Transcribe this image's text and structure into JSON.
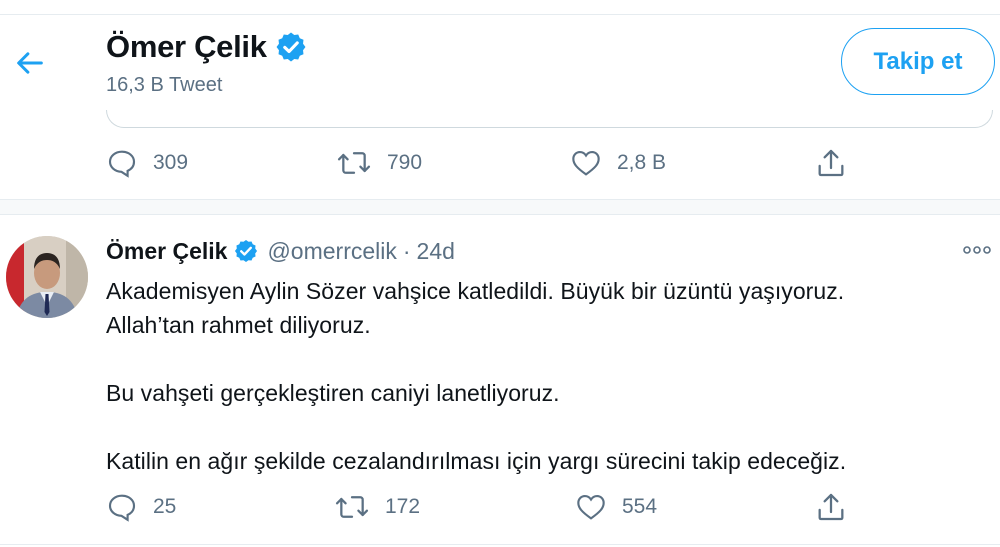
{
  "header": {
    "name": "Ömer Çelik",
    "tweet_count": "16,3 B Tweet",
    "follow_label": "Takip et"
  },
  "prev_tweet": {
    "reply_count": "309",
    "retweet_count": "790",
    "like_count": "2,8 B"
  },
  "tweet": {
    "name": "Ömer Çelik",
    "handle": "@omerrcelik",
    "separator": "·",
    "time": "24d",
    "text": "Akademisyen Aylin Sözer vahşice katledildi. Büyük bir üzüntü yaşıyoruz.\nAllah’tan rahmet diliyoruz.\n\nBu vahşeti gerçekleştiren caniyi lanetliyoruz.\n\nKatilin en ağır şekilde cezalandırılması için yargı sürecini takip edeceğiz.",
    "reply_count": "25",
    "retweet_count": "172",
    "like_count": "554"
  },
  "icons": {
    "back": "back-arrow-icon",
    "verified": "verified-badge-icon",
    "reply": "reply-bubble-icon",
    "retweet": "retweet-icon",
    "like": "heart-icon",
    "share": "share-icon",
    "more": "more-dots-icon"
  },
  "colors": {
    "accent": "#1da1f2",
    "secondary_text": "#5b7083",
    "text": "#0f1419"
  }
}
